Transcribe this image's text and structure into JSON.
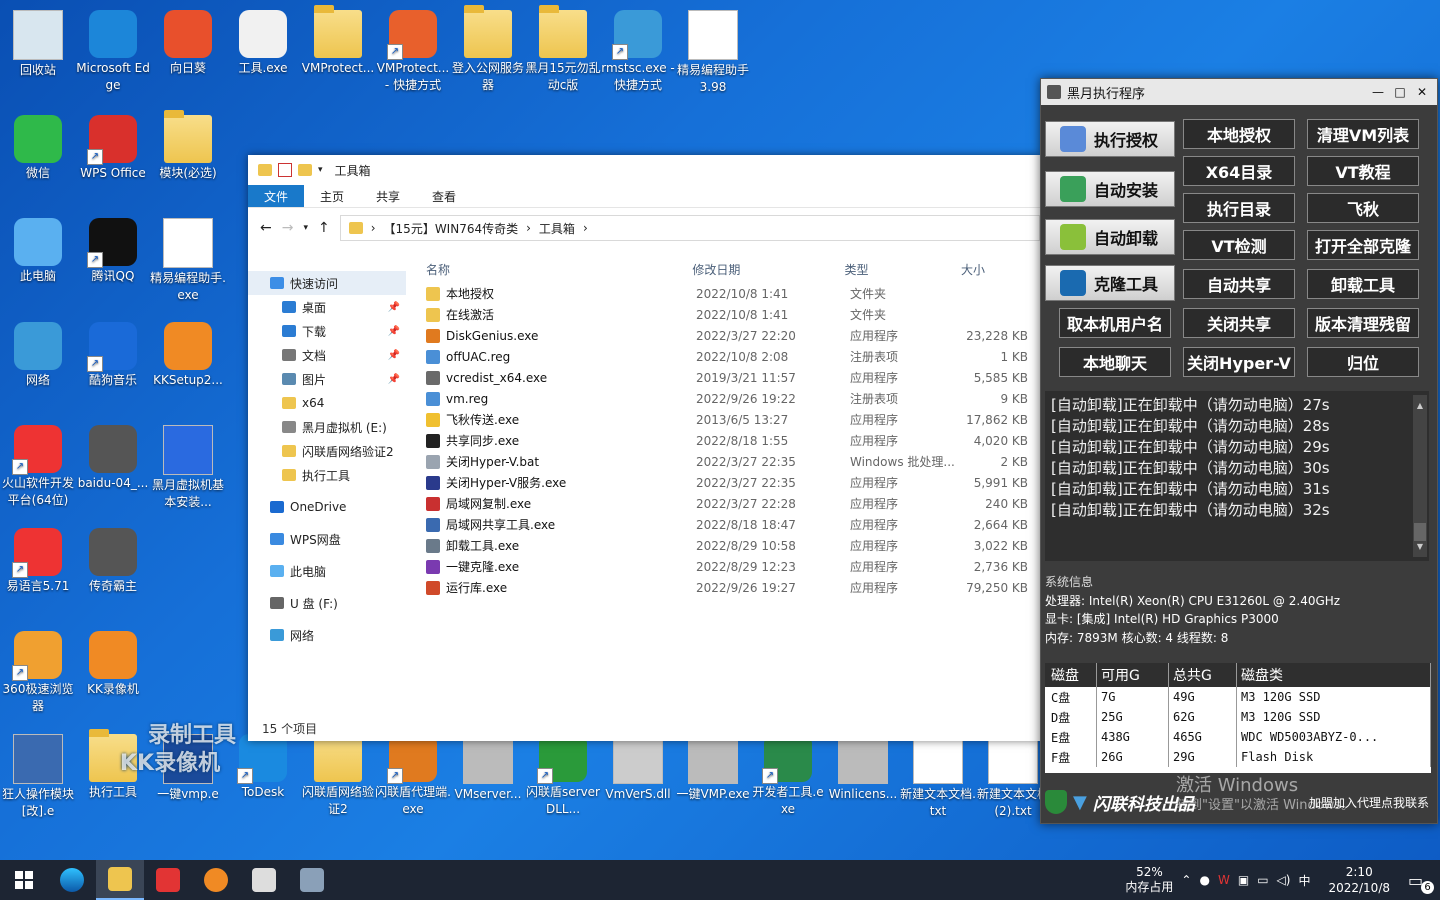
{
  "desktop": {
    "icons": [
      {
        "label": "回收站"
      },
      {
        "label": "Microsoft Edge"
      },
      {
        "label": "向日葵"
      },
      {
        "label": "工具.exe"
      },
      {
        "label": "VMProtect..."
      },
      {
        "label": "VMProtect... - 快捷方式"
      },
      {
        "label": "登入公网服务器"
      },
      {
        "label": "黑月15元勿乱动c版"
      },
      {
        "label": "rmstsc.exe - 快捷方式"
      },
      {
        "label": "精易编程助手3.98"
      },
      {
        "label": "微信"
      },
      {
        "label": "WPS Office"
      },
      {
        "label": "模块(必选)"
      },
      {
        "label": "此电脑"
      },
      {
        "label": "腾讯QQ"
      },
      {
        "label": "精易编程助手.exe"
      },
      {
        "label": "网络"
      },
      {
        "label": "酷狗音乐"
      },
      {
        "label": "KKSetup2..."
      },
      {
        "label": "火山软件开发平台(64位)"
      },
      {
        "label": "baidu-04_..."
      },
      {
        "label": "黑月虚拟机基本安装..."
      },
      {
        "label": "易语言5.71"
      },
      {
        "label": "传奇霸主"
      },
      {
        "label": "360极速浏览器"
      },
      {
        "label": "KK录像机"
      },
      {
        "label": "狂人操作模块[改].e"
      },
      {
        "label": "执行工具"
      },
      {
        "label": "一键vmp.e"
      },
      {
        "label": "ToDesk"
      },
      {
        "label": "闪联盾网络验证2"
      },
      {
        "label": "闪联盾代理端.exe"
      },
      {
        "label": "VMserver..."
      },
      {
        "label": "闪联盾serverDLL..."
      },
      {
        "label": "VmVerS.dll"
      },
      {
        "label": "一键VMP.exe"
      },
      {
        "label": "开发者工具.exe"
      },
      {
        "label": "Winlicens..."
      },
      {
        "label": "新建文本文档.txt"
      },
      {
        "label": "新建文本文档 (2).txt"
      }
    ],
    "overlay_text": [
      "录制工具",
      "KK录像机"
    ],
    "watermark": [
      "激活 Windows",
      "转到\"设置\"以激活 Windows。"
    ]
  },
  "explorer": {
    "title": "工具箱",
    "ribbon": [
      "文件",
      "主页",
      "共享",
      "查看"
    ],
    "breadcrumb": [
      "【15元】WIN764传奇类",
      "工具箱"
    ],
    "nav": [
      {
        "label": "快速访问",
        "pinned": false
      },
      {
        "label": "桌面",
        "pinned": true
      },
      {
        "label": "下载",
        "pinned": true
      },
      {
        "label": "文档",
        "pinned": true
      },
      {
        "label": "图片",
        "pinned": true
      },
      {
        "label": "x64",
        "pinned": false
      },
      {
        "label": "黑月虚拟机 (E:)",
        "pinned": false
      },
      {
        "label": "闪联盾网络验证2",
        "pinned": false
      },
      {
        "label": "执行工具",
        "pinned": false
      },
      {
        "label": "OneDrive",
        "pinned": false
      },
      {
        "label": "WPS网盘",
        "pinned": false
      },
      {
        "label": "此电脑",
        "pinned": false
      },
      {
        "label": "U 盘 (F:)",
        "pinned": false
      },
      {
        "label": "网络",
        "pinned": false
      }
    ],
    "columns": [
      "名称",
      "修改日期",
      "类型",
      "大小"
    ],
    "files": [
      {
        "name": "本地授权",
        "date": "2022/10/8 1:41",
        "type": "文件夹",
        "size": "",
        "color": "#eec54f"
      },
      {
        "name": "在线激活",
        "date": "2022/10/8 1:41",
        "type": "文件夹",
        "size": "",
        "color": "#eec54f"
      },
      {
        "name": "DiskGenius.exe",
        "date": "2022/3/27 22:20",
        "type": "应用程序",
        "size": "23,228 KB",
        "color": "#e07a1f"
      },
      {
        "name": "offUAC.reg",
        "date": "2022/10/8 2:08",
        "type": "注册表项",
        "size": "1 KB",
        "color": "#4a8fd6"
      },
      {
        "name": "vcredist_x64.exe",
        "date": "2019/3/21 11:57",
        "type": "应用程序",
        "size": "5,585 KB",
        "color": "#6a6a6a"
      },
      {
        "name": "vm.reg",
        "date": "2022/9/26 19:22",
        "type": "注册表项",
        "size": "9 KB",
        "color": "#4a8fd6"
      },
      {
        "name": "飞秋传送.exe",
        "date": "2013/6/5 13:27",
        "type": "应用程序",
        "size": "17,862 KB",
        "color": "#f0c030"
      },
      {
        "name": "共享同步.exe",
        "date": "2022/8/18 1:55",
        "type": "应用程序",
        "size": "4,020 KB",
        "color": "#222222"
      },
      {
        "name": "关闭Hyper-V.bat",
        "date": "2022/3/27 22:35",
        "type": "Windows 批处理...",
        "size": "2 KB",
        "color": "#9aa4b0"
      },
      {
        "name": "关闭Hyper-V服务.exe",
        "date": "2022/3/27 22:35",
        "type": "应用程序",
        "size": "5,991 KB",
        "color": "#2a3a8c"
      },
      {
        "name": "局域网复制.exe",
        "date": "2022/3/27 22:28",
        "type": "应用程序",
        "size": "240 KB",
        "color": "#c93030"
      },
      {
        "name": "局域网共享工具.exe",
        "date": "2022/8/18 18:47",
        "type": "应用程序",
        "size": "2,664 KB",
        "color": "#3a6ab0"
      },
      {
        "name": "卸载工具.exe",
        "date": "2022/8/29 10:58",
        "type": "应用程序",
        "size": "3,022 KB",
        "color": "#6a7a8a"
      },
      {
        "name": "一键克隆.exe",
        "date": "2022/8/29 12:23",
        "type": "应用程序",
        "size": "2,736 KB",
        "color": "#7a3ab0"
      },
      {
        "name": "运行库.exe",
        "date": "2022/9/26 19:27",
        "type": "应用程序",
        "size": "79,250 KB",
        "color": "#d04a2a"
      }
    ],
    "status": "15 个项目"
  },
  "tool": {
    "title": "黑月执行程序",
    "big_buttons": [
      {
        "label": "执行授权",
        "color": "#5a8ad8"
      },
      {
        "label": "自动安装",
        "color": "#3aa05a"
      },
      {
        "label": "自动卸载",
        "color": "#8ac03a"
      },
      {
        "label": "克隆工具",
        "color": "#1a6ab0"
      }
    ],
    "grid_buttons": [
      [
        "本地授权",
        "清理VM列表"
      ],
      [
        "X64目录",
        "VT教程"
      ],
      [
        "执行目录",
        "飞秋"
      ],
      [
        "VT检测",
        "打开全部克隆"
      ],
      [
        "自动共享",
        "卸载工具"
      ]
    ],
    "bottom_buttons": [
      [
        "取本机用户名",
        "关闭共享",
        "版本清理残留"
      ],
      [
        "本地聊天",
        "关闭Hyper-V",
        "归位"
      ]
    ],
    "log": [
      "[自动卸载]正在卸载中（请勿动电脑）27s",
      "[自动卸载]正在卸载中（请勿动电脑）28s",
      "[自动卸载]正在卸载中（请勿动电脑）29s",
      "[自动卸载]正在卸载中（请勿动电脑）30s",
      "[自动卸载]正在卸载中（请勿动电脑）31s",
      "[自动卸载]正在卸载中（请勿动电脑）32s"
    ],
    "sysinfo": {
      "header": "系统信息",
      "cpu": "处理器:  Intel(R) Xeon(R) CPU E31260L @ 2.40GHz",
      "gpu": "显卡:  [集成] Intel(R) HD Graphics P3000",
      "mem": "内存:  7893M   核心数:  4   线程数:  8"
    },
    "disk_columns": [
      "磁盘",
      "可用G",
      "总共G",
      "磁盘类"
    ],
    "disks": [
      {
        "drive": "C盘",
        "free": "7G",
        "total": "49G",
        "type": "M3 120G SSD"
      },
      {
        "drive": "D盘",
        "free": "25G",
        "total": "62G",
        "type": "M3 120G SSD"
      },
      {
        "drive": "E盘",
        "free": "438G",
        "total": "465G",
        "type": "WDC WD5003ABYZ-0..."
      },
      {
        "drive": "F盘",
        "free": "26G",
        "total": "29G",
        "type": "Flash Disk"
      }
    ],
    "brand": "闪联科技出品",
    "footer_note": "加盟加入代理点我联系"
  },
  "taskbar": {
    "mem_pct": "52%",
    "mem_label": "内存占用",
    "ime": "中",
    "time": "2:10",
    "date": "2022/10/8",
    "notif_count": "6"
  }
}
